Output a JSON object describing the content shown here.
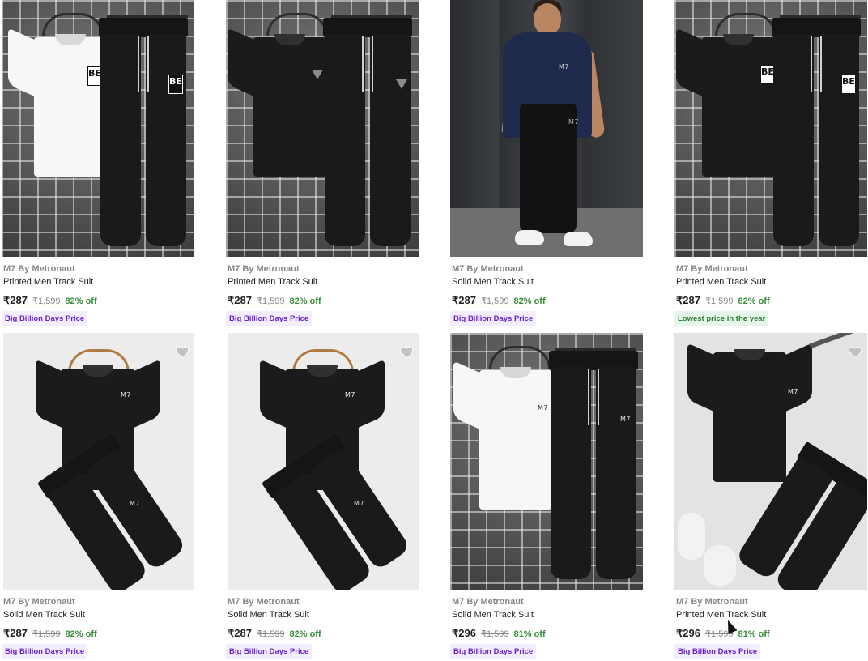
{
  "products": [
    {
      "brand": "M7 By Metronaut",
      "name": "Printed Men Track Suit",
      "price": "₹287",
      "mrp": "₹1,599",
      "discount": "82% off",
      "badge": "Big Billion Days Price",
      "badge_type": "bbd",
      "image": "white-tee-black-joggers-grid-wall",
      "print": "BE"
    },
    {
      "brand": "M7 By Metronaut",
      "name": "Printed Men Track Suit",
      "price": "₹287",
      "mrp": "₹1,599",
      "discount": "82% off",
      "badge": "Big Billion Days Price",
      "badge_type": "bbd",
      "image": "black-tee-black-joggers-grid-wall",
      "print": "triangle"
    },
    {
      "brand": "M7 By Metronaut",
      "name": "Solid Men Track Suit",
      "price": "₹287",
      "mrp": "₹1,599",
      "discount": "82% off",
      "badge": "Big Billion Days Price",
      "badge_type": "bbd",
      "image": "model-navy-tee-black-joggers"
    },
    {
      "brand": "M7 By Metronaut",
      "name": "Printed Men Track Suit",
      "price": "₹287",
      "mrp": "₹1,599",
      "discount": "82% off",
      "badge": "Lowest price in the year",
      "badge_type": "low",
      "image": "black-tee-black-joggers-grid-wall",
      "print": "BE"
    },
    {
      "brand": "M7 By Metronaut",
      "name": "Solid Men Track Suit",
      "price": "₹287",
      "mrp": "₹1,599",
      "discount": "82% off",
      "badge": "Big Billion Days Price",
      "badge_type": "bbd",
      "image": "black-tee-joggers-wooden-hanger",
      "print": "M7"
    },
    {
      "brand": "M7 By Metronaut",
      "name": "Solid Men Track Suit",
      "price": "₹287",
      "mrp": "₹1,599",
      "discount": "82% off",
      "badge": "Big Billion Days Price",
      "badge_type": "bbd",
      "image": "black-tee-joggers-wooden-hanger",
      "print": "M7"
    },
    {
      "brand": "M7 By Metronaut",
      "name": "Solid Men Track Suit",
      "price": "₹296",
      "mrp": "₹1,599",
      "discount": "81% off",
      "badge": "Big Billion Days Price",
      "badge_type": "bbd",
      "image": "white-tee-black-joggers-grid-wall",
      "print": "M7"
    },
    {
      "brand": "M7 By Metronaut",
      "name": "Printed Men Track Suit",
      "price": "₹296",
      "mrp": "₹1,599",
      "discount": "81% off",
      "badge": "Big Billion Days Price",
      "badge_type": "bbd",
      "image": "black-tee-joggers-flatlay-sneakers",
      "print": "M7"
    }
  ],
  "colors": {
    "discount": "#388e3c",
    "badge_bbd": "#6a1fd1",
    "badge_low": "#2e7d32",
    "brand": "#878787",
    "wishlist": "#c2c2c2"
  },
  "icons": {
    "wishlist": "heart-icon"
  }
}
